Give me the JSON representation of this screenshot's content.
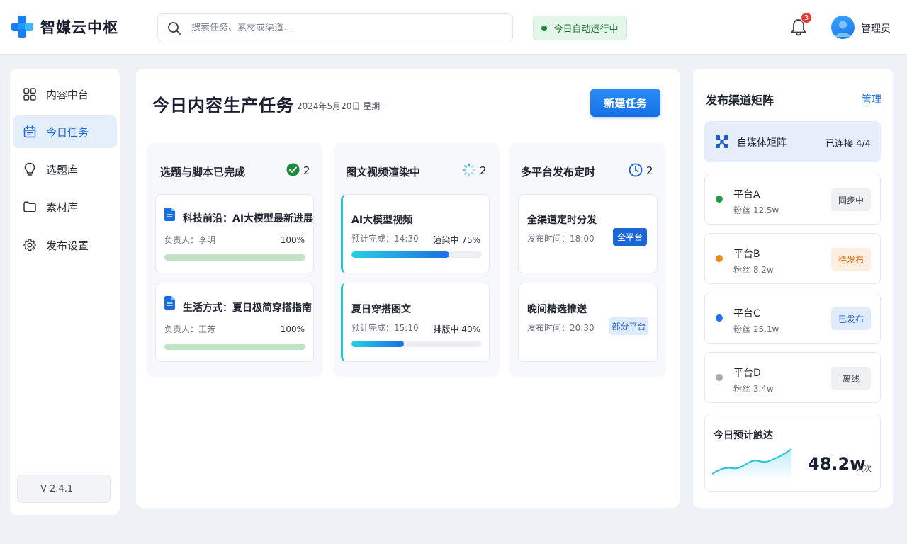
{
  "app": {
    "name": "智媒云中枢"
  },
  "search": {
    "placeholder": "搜索任务、素材或渠道..."
  },
  "status": {
    "label": "今日自动运行中",
    "color": "#1e8a3c"
  },
  "notifications": {
    "count": "3",
    "icon": "bell-icon"
  },
  "user": {
    "name": "管理员"
  },
  "sidebar": {
    "items": [
      {
        "label": "内容中台",
        "icon": "grid-icon",
        "active": false
      },
      {
        "label": "今日任务",
        "icon": "calendar-icon",
        "active": true
      },
      {
        "label": "选题库",
        "icon": "lightbulb-icon",
        "active": false
      },
      {
        "label": "素材库",
        "icon": "folder-icon",
        "active": false
      },
      {
        "label": "发布设置",
        "icon": "gear-icon",
        "active": false
      }
    ],
    "version": "V 2.4.1"
  },
  "main": {
    "title": "今日内容生产任务",
    "date": "2024年5月20日   星期一",
    "new_button": "新建任务",
    "columns": [
      {
        "title": "选题与脚本已完成",
        "count": "2",
        "icon": "check-circle-icon",
        "cards": [
          {
            "title": "科技前沿：AI大模型最新进展",
            "meta": "负责人：李明",
            "right": "100%",
            "progress": 1.0
          },
          {
            "title": "生活方式：夏日极简穿搭指南",
            "meta": "负责人：王芳",
            "right": "100%",
            "progress": 1.0
          }
        ]
      },
      {
        "title": "图文视频渲染中",
        "count": "2",
        "icon": "spinner-icon",
        "cards": [
          {
            "title": "AI大模型视频",
            "meta": "预计完成：14:30",
            "right": "渲染中 75%",
            "progress": 0.75
          },
          {
            "title": "夏日穿搭图文",
            "meta": "预计完成：15:10",
            "right": "排版中 40%",
            "progress": 0.4
          }
        ]
      },
      {
        "title": "多平台发布定时",
        "count": "2",
        "icon": "clock-icon",
        "cards": [
          {
            "title": "全渠道定时分发",
            "meta": "发布时间：18:00",
            "tag": "全平台"
          },
          {
            "title": "晚间精选推送",
            "meta": "发布时间：20:30",
            "tag": "部分平台"
          }
        ]
      }
    ]
  },
  "channels": {
    "title": "发布渠道矩阵",
    "manage": "管理",
    "matrix": {
      "label": "自媒体矩阵",
      "connected": "已连接  4/4"
    },
    "platforms": [
      {
        "name": "平台A",
        "fans": "粉丝 12.5w",
        "status": "同步中",
        "dot": "#1e9a45"
      },
      {
        "name": "平台B",
        "fans": "粉丝 8.2w",
        "status": "待发布",
        "dot": "#f08a1c"
      },
      {
        "name": "平台C",
        "fans": "粉丝 25.1w",
        "status": "已发布",
        "dot": "#1a73e8"
      },
      {
        "name": "平台D",
        "fans": "粉丝 3.4w",
        "status": "离线",
        "dot": "#a7abb3"
      }
    ],
    "reach": {
      "title": "今日预计触达",
      "value": "48.2w",
      "unit": "人次"
    }
  }
}
